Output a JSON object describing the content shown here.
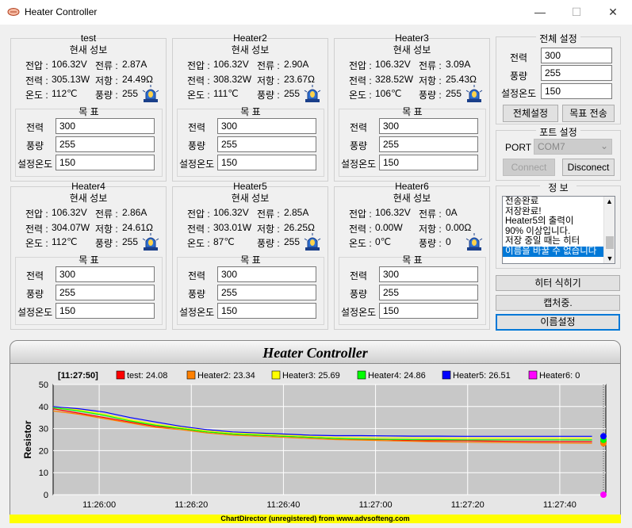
{
  "window": {
    "title": "Heater Controller",
    "minimize": "—",
    "maximize": "☐",
    "close": "✕"
  },
  "heaters": [
    {
      "name": "test",
      "current_title": "현새 성보",
      "voltage_label": "전압 :",
      "voltage": "106.32V",
      "current_label": "전류 :",
      "current": "2.87A",
      "power_label": "전력 :",
      "power": "305.13W",
      "resist_label": "저항 :",
      "resist": "24.49Ω",
      "temp_label": "온도 :",
      "temp": "112℃",
      "flow_label": "풍량 :",
      "flow": "255",
      "target_title": "목 표",
      "t_power_label": "전력",
      "t_power": "300",
      "t_flow_label": "풍량",
      "t_flow": "255",
      "t_temp_label": "설정온도",
      "t_temp": "150"
    },
    {
      "name": "Heater2",
      "current_title": "현새 성보",
      "voltage_label": "전압 :",
      "voltage": "106.32V",
      "current_label": "전류 :",
      "current": "2.90A",
      "power_label": "전력 :",
      "power": "308.32W",
      "resist_label": "저항 :",
      "resist": "23.67Ω",
      "temp_label": "온도 :",
      "temp": "111℃",
      "flow_label": "풍량 :",
      "flow": "255",
      "target_title": "목 표",
      "t_power_label": "전력",
      "t_power": "300",
      "t_flow_label": "풍량",
      "t_flow": "255",
      "t_temp_label": "설정온도",
      "t_temp": "150"
    },
    {
      "name": "Heater3",
      "current_title": "현새 성보",
      "voltage_label": "전압 :",
      "voltage": "106.32V",
      "current_label": "전류 :",
      "current": "3.09A",
      "power_label": "전력 :",
      "power": "328.52W",
      "resist_label": "저항 :",
      "resist": "25.43Ω",
      "temp_label": "온도 :",
      "temp": "106℃",
      "flow_label": "풍량 :",
      "flow": "255",
      "target_title": "목 표",
      "t_power_label": "전력",
      "t_power": "300",
      "t_flow_label": "풍량",
      "t_flow": "255",
      "t_temp_label": "설정온도",
      "t_temp": "150"
    },
    {
      "name": "Heater4",
      "current_title": "현새 성보",
      "voltage_label": "전압 :",
      "voltage": "106.32V",
      "current_label": "전류 :",
      "current": "2.86A",
      "power_label": "전력 :",
      "power": "304.07W",
      "resist_label": "저항 :",
      "resist": "24.61Ω",
      "temp_label": "온도 :",
      "temp": "112℃",
      "flow_label": "풍량 :",
      "flow": "255",
      "target_title": "목 표",
      "t_power_label": "전력",
      "t_power": "300",
      "t_flow_label": "풍량",
      "t_flow": "255",
      "t_temp_label": "설정온도",
      "t_temp": "150"
    },
    {
      "name": "Heater5",
      "current_title": "현새 성보",
      "voltage_label": "전압 :",
      "voltage": "106.32V",
      "current_label": "전류 :",
      "current": "2.85A",
      "power_label": "전력 :",
      "power": "303.01W",
      "resist_label": "저항 :",
      "resist": "26.25Ω",
      "temp_label": "온도 :",
      "temp": "87℃",
      "flow_label": "풍량 :",
      "flow": "255",
      "target_title": "목 표",
      "t_power_label": "전력",
      "t_power": "300",
      "t_flow_label": "풍량",
      "t_flow": "255",
      "t_temp_label": "설정온도",
      "t_temp": "150"
    },
    {
      "name": "Heater6",
      "current_title": "현새 성보",
      "voltage_label": "전압 :",
      "voltage": "106.32V",
      "current_label": "전류 :",
      "current": "0A",
      "power_label": "전력 :",
      "power": "0.00W",
      "resist_label": "저항 :",
      "resist": "0.00Ω",
      "temp_label": "온도 :",
      "temp": "0℃",
      "flow_label": "풍량 :",
      "flow": "0",
      "target_title": "목 표",
      "t_power_label": "전력",
      "t_power": "300",
      "t_flow_label": "풍량",
      "t_flow": "255",
      "t_temp_label": "설정온도",
      "t_temp": "150"
    }
  ],
  "global": {
    "title": "전체 설정",
    "power_label": "전력",
    "power": "300",
    "flow_label": "풍량",
    "flow": "255",
    "temp_label": "설정온도",
    "temp": "150",
    "apply_all": "전체설정",
    "send_target": "목표 전송"
  },
  "port": {
    "title": "포트 설정",
    "port_label": "PORT",
    "selected": "COM7",
    "connect": "Connect",
    "disconnect": "Disconect"
  },
  "info": {
    "title": "정 보",
    "lines": [
      "전송완료",
      "저장완료!",
      "Heater5의 출력이",
      "90% 이상입니다.",
      "저장 중일 때는 히터",
      "이름을 바꿀 수 없습니다"
    ]
  },
  "actions": {
    "cool": "히터 식히기",
    "capture": "캡처중.",
    "rename": "이름설정"
  },
  "chart_data": {
    "type": "line",
    "title": "Heater Controller",
    "timestamp": "[11:27:50]",
    "ylabel": "Resistor",
    "xlabel": "",
    "ylim": [
      0,
      50
    ],
    "yticks": [
      "0",
      "10",
      "20",
      "30",
      "40",
      "50"
    ],
    "xticks": [
      "11:26:00",
      "11:26:20",
      "11:26:40",
      "11:27:00",
      "11:27:20",
      "11:27:40"
    ],
    "xrange_seconds": [
      -10,
      110
    ],
    "tick_seconds": [
      0,
      20,
      40,
      60,
      80,
      100
    ],
    "grid": true,
    "legend_position": "top",
    "series": [
      {
        "name": "test",
        "legend": "test: 24.08",
        "color": "#ff0000",
        "values": [
          39,
          37,
          35,
          33,
          31,
          30,
          28.5,
          27.5,
          27,
          26.5,
          26,
          25.5,
          25,
          25,
          24.5,
          24.5,
          24.5,
          24.3,
          24.2,
          24.1,
          24.1,
          24.08
        ],
        "end": 24.08
      },
      {
        "name": "Heater2",
        "legend": "Heater2: 23.34",
        "color": "#ff8000",
        "values": [
          38,
          36.5,
          34.5,
          32.5,
          30.5,
          29.5,
          28,
          27,
          26.5,
          26,
          25.5,
          25,
          24.8,
          24.5,
          24.2,
          24,
          23.8,
          23.7,
          23.6,
          23.5,
          23.4,
          23.34
        ],
        "end": 23.34
      },
      {
        "name": "Heater3",
        "legend": "Heater3: 25.69",
        "color": "#ffff00",
        "values": [
          40,
          38.5,
          36.5,
          34,
          32,
          30.5,
          29,
          28,
          27.5,
          27,
          26.5,
          26,
          26,
          25.8,
          25.8,
          25.7,
          25.7,
          25.7,
          25.7,
          25.7,
          25.7,
          25.69
        ],
        "end": 25.69
      },
      {
        "name": "Heater4",
        "legend": "Heater4: 24.86",
        "color": "#00ff00",
        "values": [
          39.5,
          38,
          36,
          33.5,
          31.5,
          30,
          28.5,
          27.5,
          27,
          26.5,
          26,
          25.5,
          25.3,
          25.1,
          25,
          25,
          24.9,
          24.9,
          24.9,
          24.9,
          24.9,
          24.86
        ],
        "end": 24.86
      },
      {
        "name": "Heater5",
        "legend": "Heater5: 26.51",
        "color": "#0000ff",
        "values": [
          40,
          39,
          37.5,
          35,
          33,
          31,
          29.5,
          28.5,
          28,
          27.5,
          27,
          26.8,
          26.8,
          26.7,
          26.6,
          26.6,
          26.5,
          26.5,
          26.5,
          26.5,
          26.5,
          26.51
        ],
        "end": 26.51
      },
      {
        "name": "Heater6",
        "legend": "Heater6: 0",
        "color": "#ff00ff",
        "values": [],
        "end": 0
      }
    ],
    "footer": "ChartDirector (unregistered) from www.advsofteng.com"
  }
}
